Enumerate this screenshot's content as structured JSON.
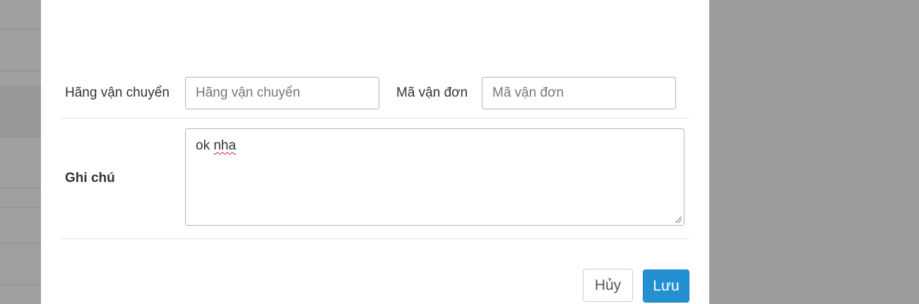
{
  "form": {
    "carrier_label": "Hãng vận chuyển",
    "carrier_placeholder": "Hãng vận chuyển",
    "carrier_value": "",
    "tracking_label": "Mã vận đơn",
    "tracking_placeholder": "Mã vận đơn",
    "tracking_value": "",
    "note_label": "Ghi chú",
    "note_value_word1": "ok",
    "note_value_word2": "nha"
  },
  "buttons": {
    "cancel_label": "Hủy",
    "save_label": "Lưu"
  },
  "colors": {
    "primary": "#2390d2",
    "overlay": "#9b9b9b",
    "spellcheck": "#e02020"
  }
}
